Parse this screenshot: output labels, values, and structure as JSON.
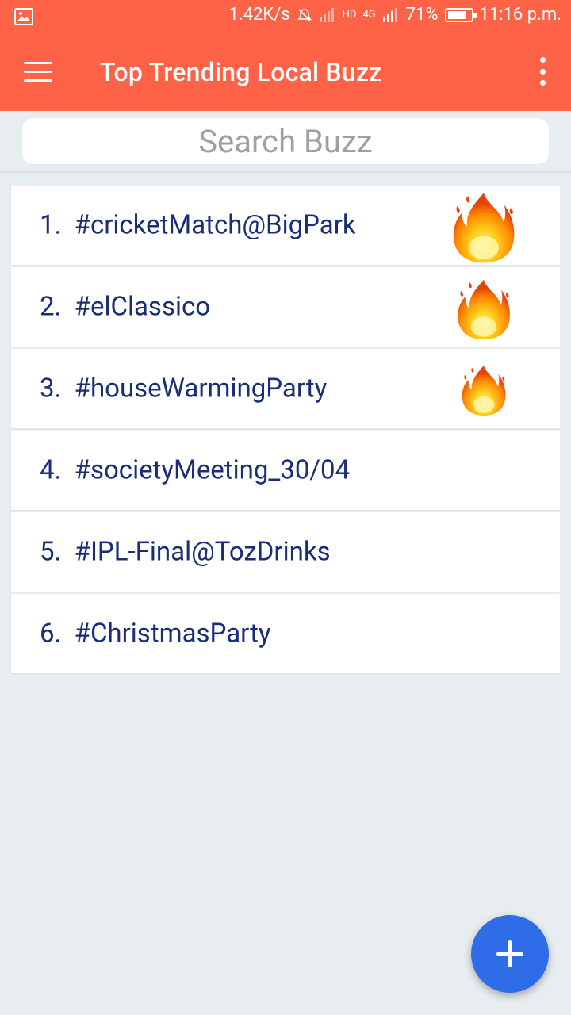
{
  "status_bar": {
    "speed": "1.42K/s",
    "battery": "71%",
    "time": "11:16 p.m.",
    "network": "4G",
    "hd": "HD"
  },
  "app_bar": {
    "title": "Top Trending Local Buzz"
  },
  "search": {
    "placeholder": "Search Buzz"
  },
  "buzz_list": [
    {
      "rank": "1.",
      "tag": "#cricketMatch@BigPark",
      "fire_level": 3
    },
    {
      "rank": "2.",
      "tag": "#elClassico",
      "fire_level": 2
    },
    {
      "rank": "3.",
      "tag": "#houseWarmingParty",
      "fire_level": 1
    },
    {
      "rank": "4.",
      "tag": "#societyMeeting_30/04",
      "fire_level": 0
    },
    {
      "rank": "5.",
      "tag": "#IPL-Final@TozDrinks",
      "fire_level": 0
    },
    {
      "rank": "6.",
      "tag": "#ChristmasParty",
      "fire_level": 0
    }
  ],
  "colors": {
    "app_bar": "#ff6347",
    "background": "#e8edf0",
    "list_text": "#1a2e78",
    "fab": "#2f6de8"
  },
  "fab": {
    "icon": "plus-icon"
  }
}
